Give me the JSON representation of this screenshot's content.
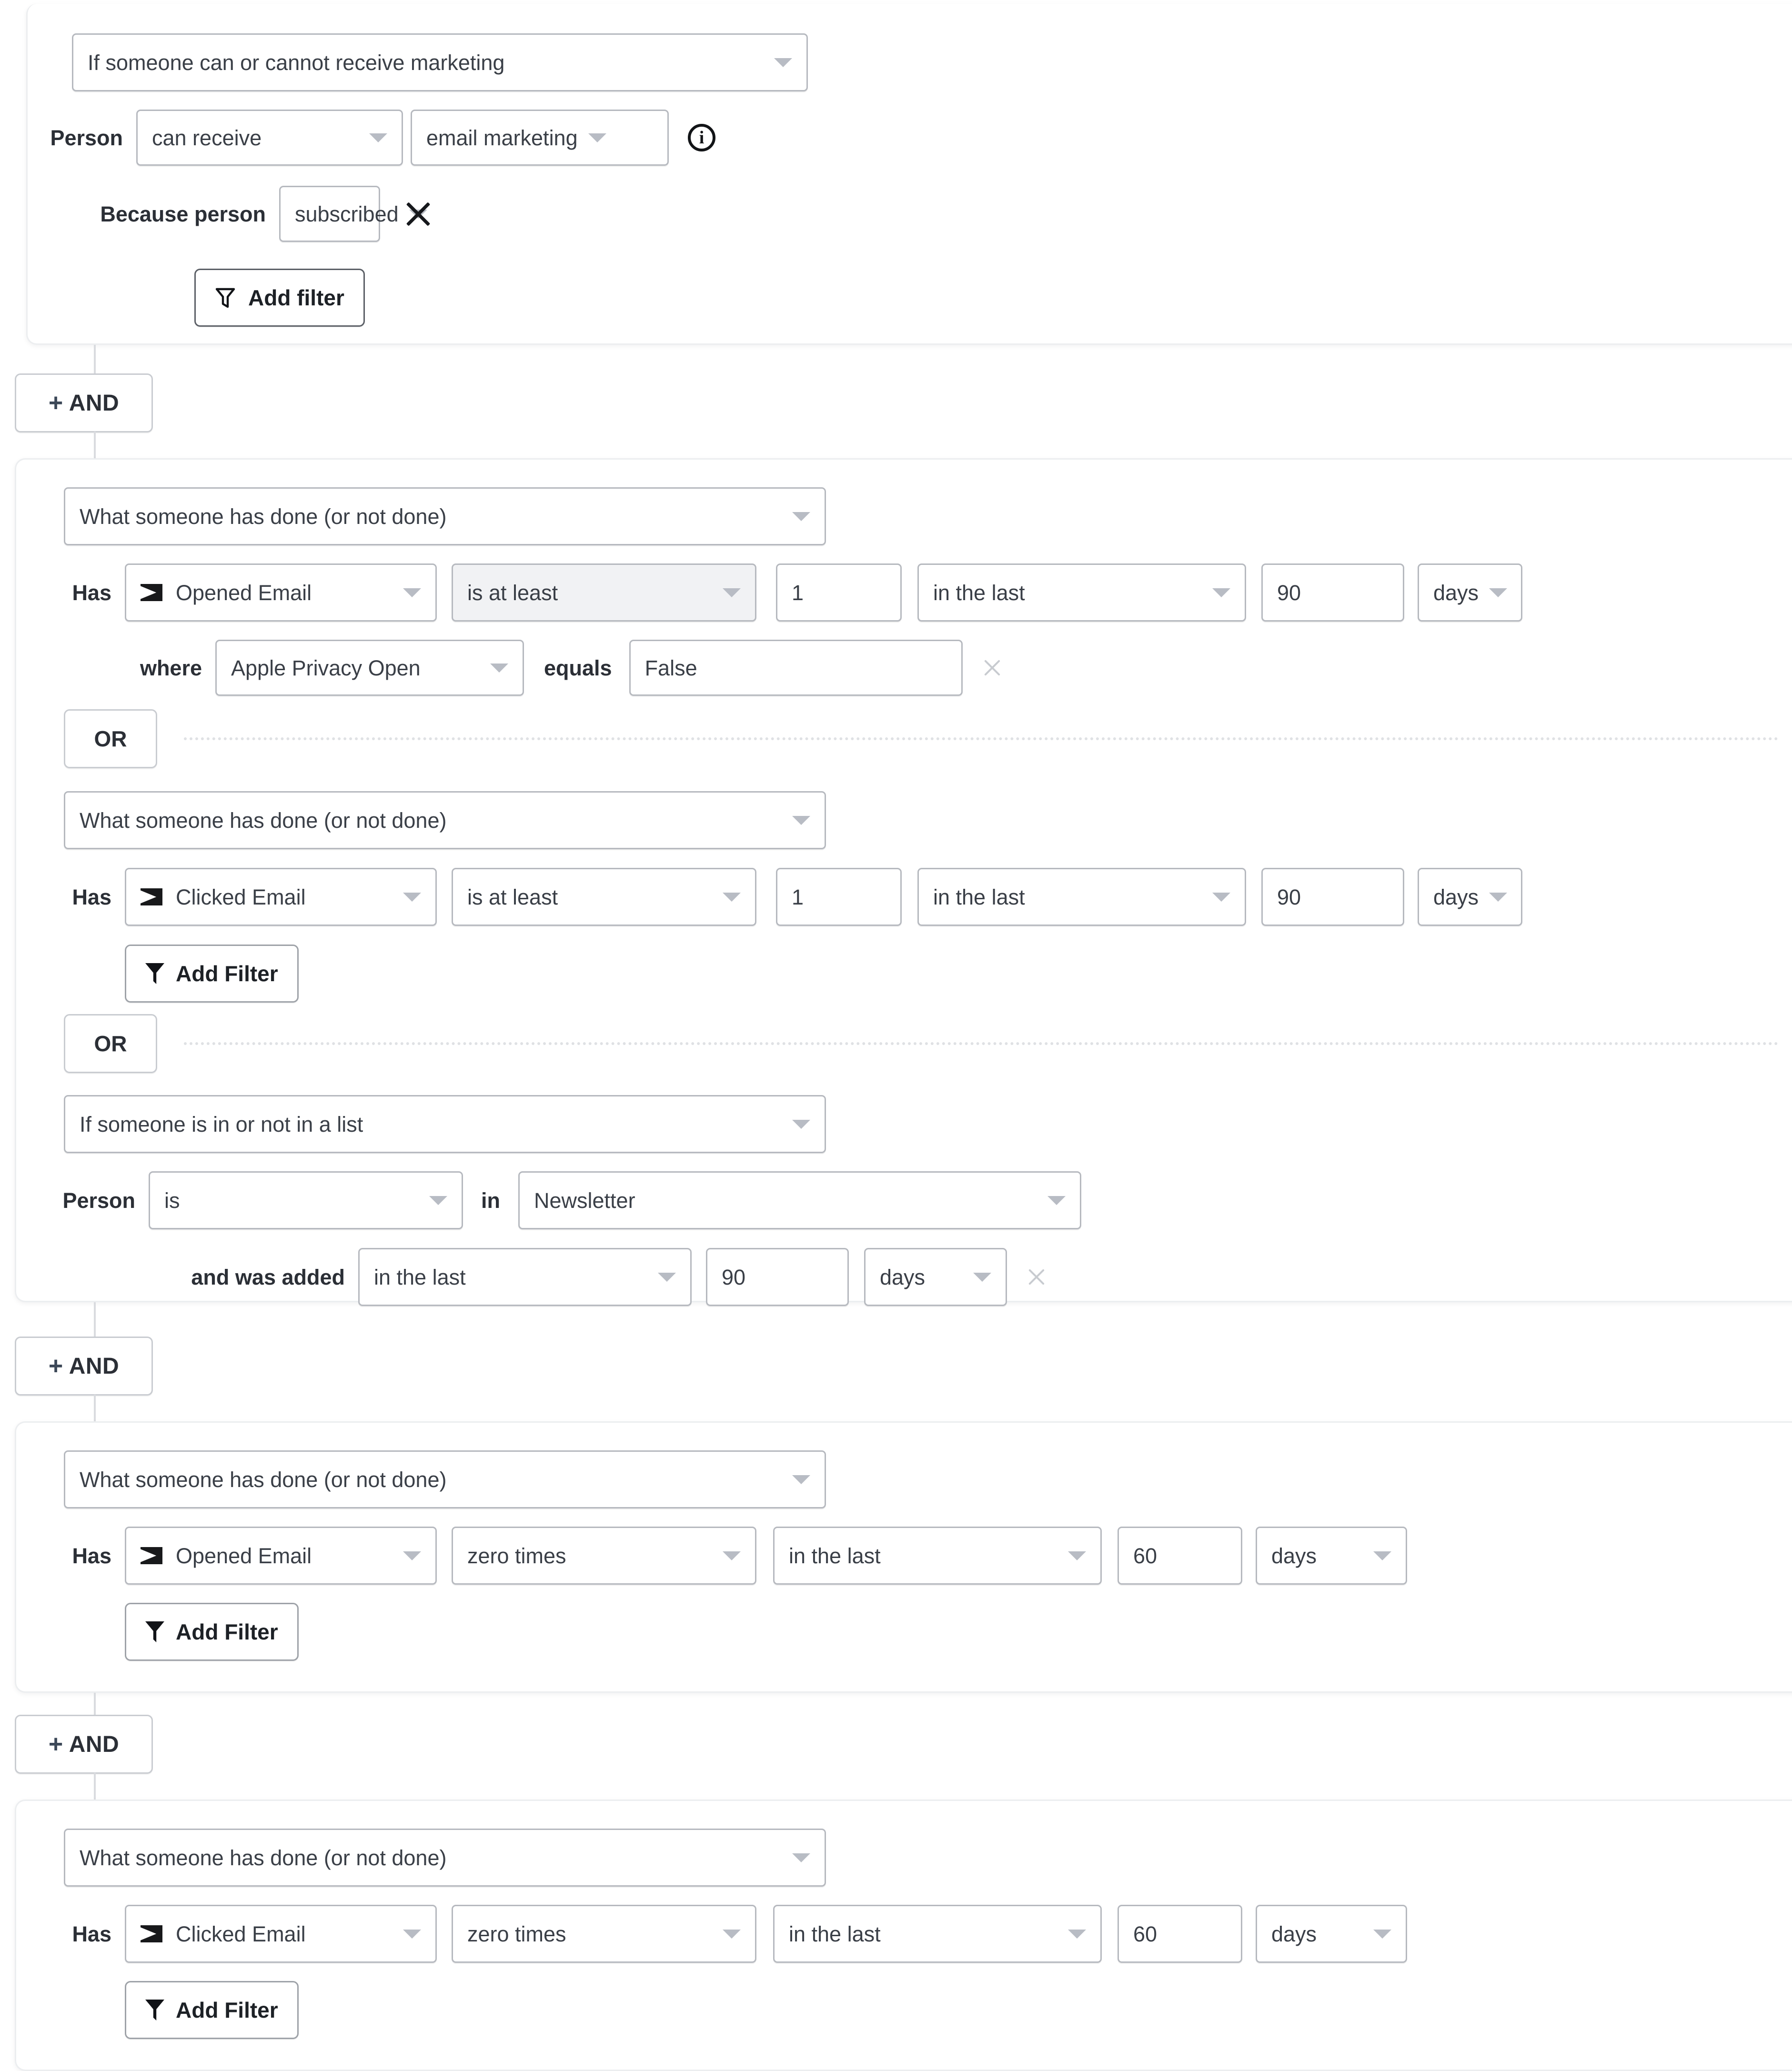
{
  "blocks": [
    {
      "type_select": "If someone can or cannot receive marketing",
      "person_label": "Person",
      "can_receive": "can receive",
      "channel": "email marketing",
      "info_icon": "info-circle-icon",
      "because_label": "Because person",
      "because_value": "subscribed",
      "remove_icon": "close-icon",
      "add_filter": "Add filter"
    }
  ],
  "and_buttons": [
    {
      "plus": "+",
      "label": "AND"
    },
    {
      "plus": "+",
      "label": "AND"
    },
    {
      "plus": "+",
      "label": "AND"
    }
  ],
  "or_buttons": [
    {
      "label": "OR"
    },
    {
      "label": "OR"
    }
  ],
  "group2": {
    "cond1": {
      "type_select": "What someone has done (or not done)",
      "has_label": "Has",
      "metric_icon": "email-icon",
      "metric": "Opened Email",
      "operator": "is at least",
      "count": "1",
      "timeframe": "in the last",
      "amount": "90",
      "unit": "days",
      "where_label": "where",
      "where_property": "Apple Privacy Open",
      "equals_label": "equals",
      "equals_value": "False",
      "remove_icon": "close-icon"
    },
    "cond2": {
      "type_select": "What someone has done (or not done)",
      "has_label": "Has",
      "metric_icon": "email-icon",
      "metric": "Clicked Email",
      "operator": "is at least",
      "count": "1",
      "timeframe": "in the last",
      "amount": "90",
      "unit": "days",
      "add_filter": "Add Filter"
    },
    "cond3": {
      "type_select": "If someone is in or not in a list",
      "person_label": "Person",
      "membership": "is",
      "in_label": "in",
      "list_name": "Newsletter",
      "added_label": "and was added",
      "timeframe": "in the last",
      "amount": "90",
      "unit": "days",
      "remove_icon": "close-icon"
    }
  },
  "group3": {
    "cond1": {
      "type_select": "What someone has done (or not done)",
      "has_label": "Has",
      "metric_icon": "email-icon",
      "metric": "Opened Email",
      "operator": "zero times",
      "timeframe": "in the last",
      "amount": "60",
      "unit": "days",
      "add_filter": "Add Filter"
    }
  },
  "group4": {
    "cond1": {
      "type_select": "What someone has done (or not done)",
      "has_label": "Has",
      "metric_icon": "email-icon",
      "metric": "Clicked Email",
      "operator": "zero times",
      "timeframe": "in the last",
      "amount": "60",
      "unit": "days",
      "add_filter": "Add Filter"
    }
  },
  "colors": {
    "panel_border": "#eceef0",
    "control_border": "#b6b9bf",
    "focus_bg": "#f1f2f4",
    "text": "#3a3f47",
    "accent_plus": "#3c4858"
  }
}
